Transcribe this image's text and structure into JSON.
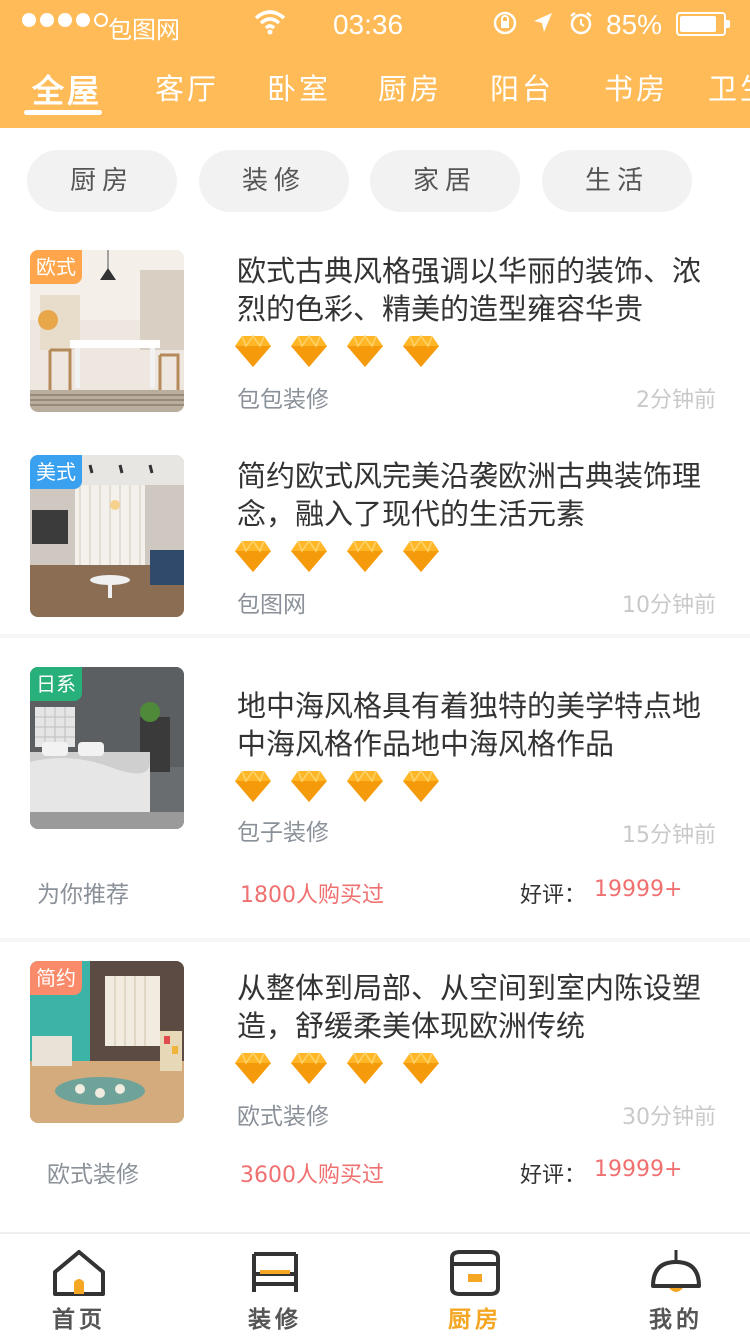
{
  "status_bar": {
    "carrier": "包图网",
    "time": "03:36",
    "battery": "85%"
  },
  "top_tabs": [
    "全屋",
    "客厅",
    "卧室",
    "厨房",
    "阳台",
    "书房",
    "卫生"
  ],
  "chips": [
    "厨房",
    "装修",
    "家居",
    "生活"
  ],
  "articles": [
    {
      "tag": "欧式",
      "tag_color": "#ffa64d",
      "title": "欧式古典风格强调以华丽的装饰、浓烈的色彩、精美的造型雍容华贵",
      "source": "包包装修",
      "time": "2分钟前"
    },
    {
      "tag": "美式",
      "tag_color": "#3aa0f0",
      "title": "简约欧式风完美沿袭欧洲古典装饰理念，融入了现代的生活元素",
      "source": "包图网",
      "time": "10分钟前"
    },
    {
      "tag": "日系",
      "tag_color": "#27b07a",
      "title": "地中海风格具有着独特的美学特点地中海风格作品地中海风格作品",
      "source": "包子装修",
      "time": "15分钟前",
      "extra_left": "为你推荐",
      "buyers": "1800人购买过",
      "rating_label": "好评：",
      "rating_value": "19999+"
    },
    {
      "tag": "简约",
      "tag_color": "#f98a6a",
      "title": "从整体到局部、从空间到室内陈设塑造，舒缓柔美体现欧洲传统",
      "source": "欧式装修",
      "time": "30分钟前",
      "extra_left": "欧式装修",
      "buyers": "3600人购买过",
      "rating_label": "好评：",
      "rating_value": "19999+"
    }
  ],
  "bottom_nav": [
    {
      "label": "首页",
      "icon": "home-icon"
    },
    {
      "label": "装修",
      "icon": "bed-icon"
    },
    {
      "label": "厨房",
      "icon": "cooker-icon"
    },
    {
      "label": "我的",
      "icon": "lamp-icon"
    }
  ],
  "colors": {
    "brand": "#ffbb57",
    "active_nav": "#f5a623",
    "price_red": "#f07070"
  }
}
